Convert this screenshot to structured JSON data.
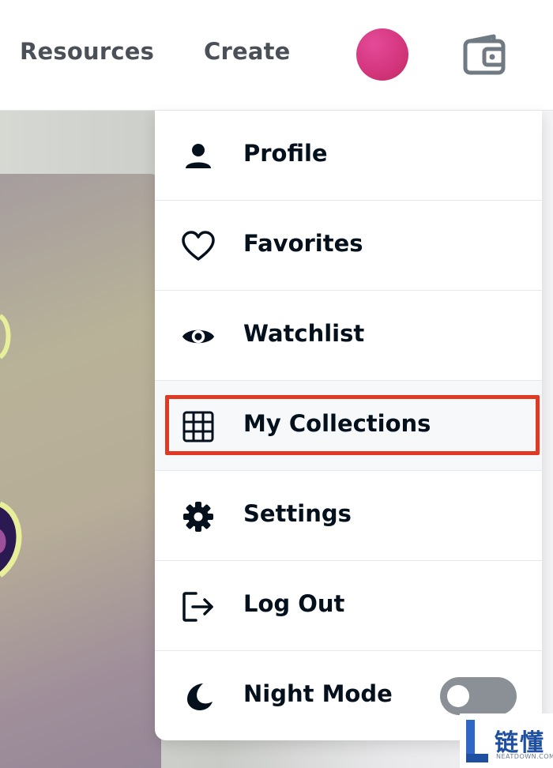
{
  "header": {
    "nav": [
      {
        "label": "Resources"
      },
      {
        "label": "Create"
      }
    ],
    "avatar_color": "#d5377f",
    "wallet_icon": "wallet-icon"
  },
  "menu": {
    "items": [
      {
        "label": "Profile",
        "icon": "person-icon"
      },
      {
        "label": "Favorites",
        "icon": "heart-icon"
      },
      {
        "label": "Watchlist",
        "icon": "eye-icon"
      },
      {
        "label": "My Collections",
        "icon": "grid-icon",
        "highlighted": true
      },
      {
        "label": "Settings",
        "icon": "gear-icon"
      },
      {
        "label": "Log Out",
        "icon": "logout-icon"
      },
      {
        "label": "Night Mode",
        "icon": "moon-icon",
        "toggle_on": false
      }
    ],
    "highlight_color": "#e03a25"
  },
  "watermark": {
    "cn": "链懂",
    "en": "NEATDOWN.COM"
  }
}
